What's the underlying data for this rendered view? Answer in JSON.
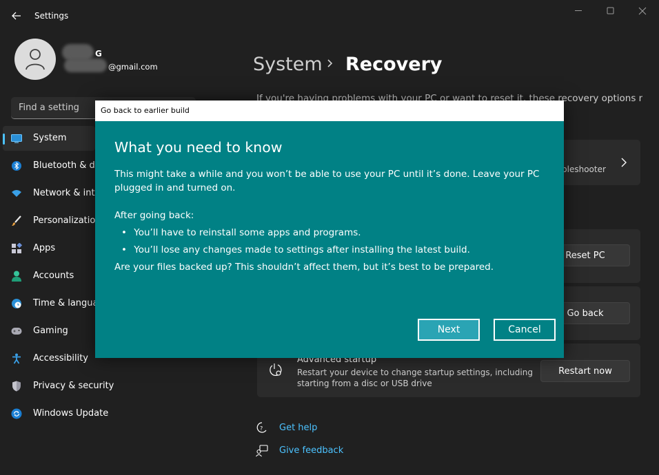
{
  "window": {
    "title": "Settings"
  },
  "profile": {
    "name": "G",
    "email": "@gmail.com"
  },
  "search": {
    "placeholder": "Find a setting"
  },
  "nav": {
    "items": [
      {
        "label": "System",
        "icon": "monitor-icon",
        "selected": true
      },
      {
        "label": "Bluetooth & devices",
        "icon": "bluetooth-icon"
      },
      {
        "label": "Network & internet",
        "icon": "wifi-icon"
      },
      {
        "label": "Personalization",
        "icon": "brush-icon"
      },
      {
        "label": "Apps",
        "icon": "apps-icon"
      },
      {
        "label": "Accounts",
        "icon": "person-icon"
      },
      {
        "label": "Time & language",
        "icon": "globe-clock-icon"
      },
      {
        "label": "Gaming",
        "icon": "gamepad-icon"
      },
      {
        "label": "Accessibility",
        "icon": "accessibility-icon"
      },
      {
        "label": "Privacy & security",
        "icon": "shield-icon"
      },
      {
        "label": "Windows Update",
        "icon": "update-icon"
      }
    ]
  },
  "header": {
    "parent": "System",
    "current": "Recovery"
  },
  "main": {
    "intro": "If you're having problems with your PC or want to reset it, these recovery options might",
    "troubleshooter_partial": "bleshooter",
    "reset_button": "Reset PC",
    "goback_button": "Go back",
    "advanced": {
      "title": "Advanced startup",
      "desc_line1": "Restart your device to change startup settings, including",
      "desc_line2": "starting from a disc or USB drive",
      "button": "Restart now"
    },
    "links": {
      "help": "Get help",
      "feedback": "Give feedback"
    }
  },
  "dialog": {
    "title": "Go back to earlier build",
    "heading": "What you need to know",
    "paragraph": "This might take a while and you won’t be able to use your PC until it’s done. Leave your PC plugged in and turned on.",
    "after_label": "After going back:",
    "bullets": [
      "You’ll have to reinstall some apps and programs.",
      "You’ll lose any changes made to settings after installing the latest build."
    ],
    "question": "Are your files backed up? This shouldn’t affect them, but it’s best to be prepared.",
    "next_button": "Next",
    "cancel_button": "Cancel"
  },
  "colors": {
    "accent": "#4cc2ff",
    "dialog_bg": "#018185",
    "primary_button": "#2aa4b4"
  }
}
